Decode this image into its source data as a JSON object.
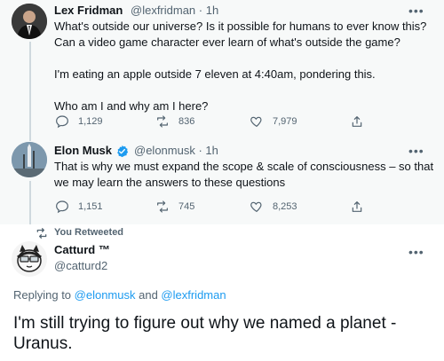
{
  "tweet1": {
    "author_name": "Lex Fridman",
    "handle": "@lexfridman",
    "time": "1h",
    "text_lines": [
      "What's outside our universe? Is it possible for humans to ever know this?",
      "Can a video game character ever learn of what's outside the game?",
      "",
      "I'm eating an apple outside 7 eleven at 4:40am, pondering this.",
      "",
      "Who am I and why am I here?"
    ],
    "replies": "1,129",
    "retweets": "836",
    "likes": "7,979",
    "icons": {
      "reply": "reply-icon",
      "retweet": "retweet-icon",
      "like": "heart-icon",
      "share": "share-icon"
    }
  },
  "tweet2": {
    "author_name": "Elon Musk",
    "handle": "@elonmusk",
    "time": "1h",
    "verified": true,
    "text_lines": [
      "That is why we must expand the scope & scale of consciousness – so that",
      "we may learn the answers to these questions"
    ],
    "replies": "1,151",
    "retweets": "745",
    "likes": "8,253"
  },
  "retweet_banner": {
    "label": "You Retweeted"
  },
  "tweet3": {
    "author_name": "Catturd ™",
    "handle": "@catturd2",
    "replying_prefix": "Replying to ",
    "replying_user1": "@elonmusk",
    "replying_and": " and ",
    "replying_user2": "@lexfridman",
    "text": "I'm still trying to figure out why we named a planet - Uranus."
  },
  "colors": {
    "link_blue": "#1d9bf0",
    "secondary_text": "#536471",
    "primary_text": "#0f1419",
    "thread_bg": "#f7f9f9",
    "verified_blue": "#1d9bf0"
  },
  "more_glyph": "•••",
  "time_separator": " · "
}
